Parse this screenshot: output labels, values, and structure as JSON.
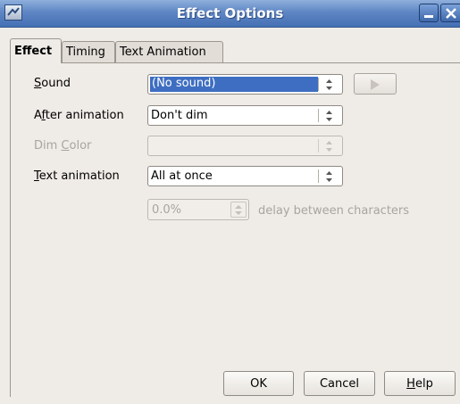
{
  "window": {
    "title": "Effect Options"
  },
  "tabs": [
    {
      "label": "Effect"
    },
    {
      "label": "Timing"
    },
    {
      "label": "Text Animation"
    }
  ],
  "sound": {
    "label_pre": "",
    "label_mnemonic": "S",
    "label_post": "ound",
    "value": "(No sound)"
  },
  "after_animation": {
    "label_pre": "A",
    "label_mnemonic": "f",
    "label_post": "ter animation",
    "value": "Don't dim"
  },
  "dim_color": {
    "label_pre": "Dim ",
    "label_mnemonic": "C",
    "label_post": "olor",
    "value": ""
  },
  "text_animation": {
    "label_pre": "",
    "label_mnemonic": "T",
    "label_post": "ext animation",
    "value": "All at once"
  },
  "delay": {
    "value": "0.0%",
    "suffix": "delay between characters"
  },
  "buttons": {
    "ok": "OK",
    "cancel": "Cancel",
    "help_mnemonic": "H",
    "help_rest": "elp"
  },
  "colors": {
    "selection": "#3e6ec1",
    "titlebar": "#4f7bbf",
    "disabled_text": "#a8a59f"
  }
}
